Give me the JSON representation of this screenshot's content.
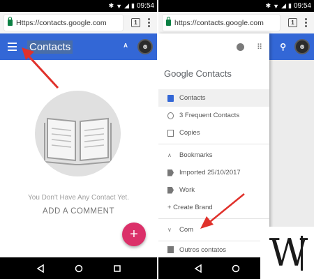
{
  "status": {
    "time": "09:54"
  },
  "left": {
    "url": "Https://contacts.google.com",
    "tab_count": "1",
    "app_title": "Contacts",
    "empty_text": "You Don't Have Any Contact Yet.",
    "add_link": "ADD A COMMENT",
    "fab_label": "+"
  },
  "right": {
    "url": "https://contacts.google.com",
    "tab_count": "1",
    "drawer_title": "Google Contacts",
    "drawer_items": [
      {
        "label": "Contacts",
        "icon": "contacts-icon"
      },
      {
        "label": "3 Frequent Contacts",
        "icon": "history-icon"
      },
      {
        "label": "Copies",
        "icon": "copy-icon"
      }
    ],
    "bookmarks_header": "Bookmarks",
    "label_items": [
      {
        "label": "Imported 25/10/2017",
        "icon": "label-icon"
      },
      {
        "label": "Work",
        "icon": "label-icon"
      }
    ],
    "create_label": "+ Create Brand",
    "collapse_item": "Com",
    "other_contacts": "Outros contatos"
  },
  "logo_text": "W",
  "colors": {
    "appbar": "#3367d6",
    "fab": "#db3069",
    "arrow": "#e0312b"
  }
}
